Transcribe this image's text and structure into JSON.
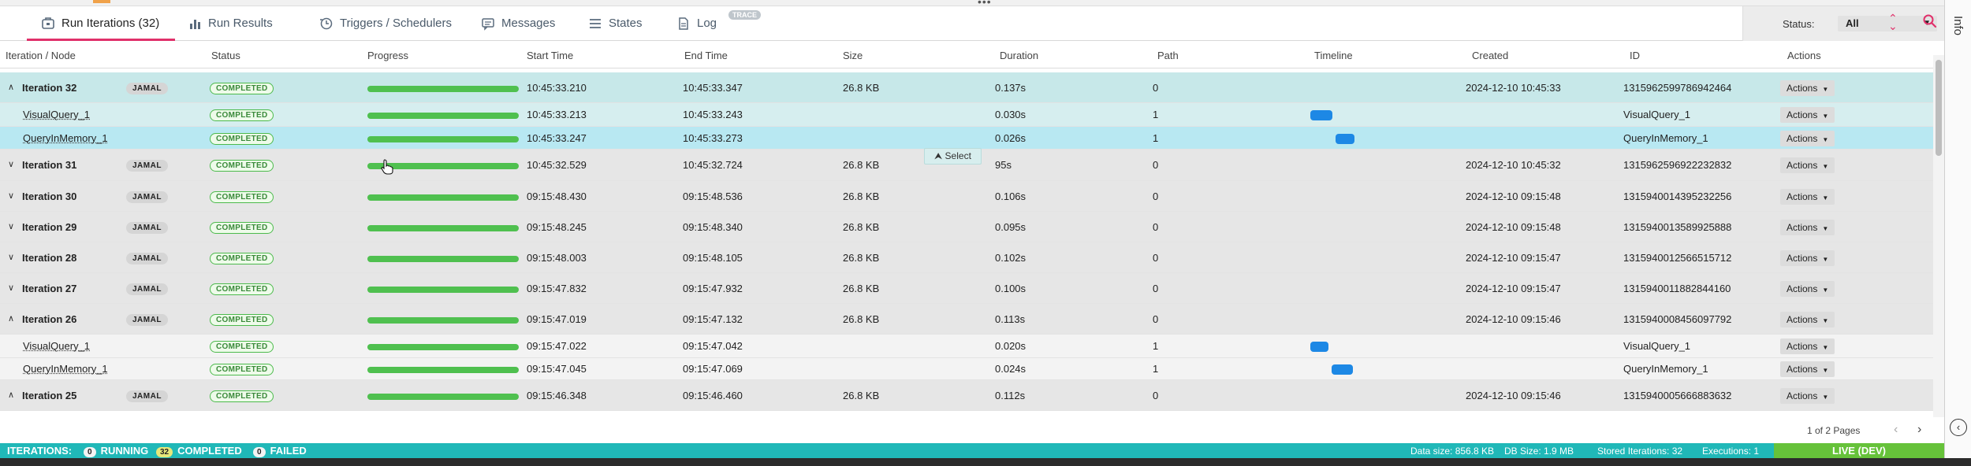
{
  "tabs": [
    {
      "label": "Run Iterations (32)",
      "icon": "run-iterations-icon"
    },
    {
      "label": "Run Results",
      "icon": "bar-chart-icon"
    },
    {
      "label": "Triggers / Schedulers",
      "icon": "triggers-icon"
    },
    {
      "label": "Messages",
      "icon": "messages-icon"
    },
    {
      "label": "States",
      "icon": "list-icon"
    },
    {
      "label": "Log",
      "icon": "log-icon"
    }
  ],
  "trace_badge": "TRACE",
  "filter": {
    "label": "Status:",
    "value": "All"
  },
  "info_label": "Info",
  "columns": [
    "Iteration / Node",
    "Status",
    "Progress",
    "Start Time",
    "End Time",
    "Size",
    "Duration",
    "Path",
    "Timeline",
    "Created",
    "ID",
    "Actions"
  ],
  "rows": [
    {
      "kind": "iter",
      "expanded": true,
      "name": "Iteration 32",
      "user": "JAMAL",
      "status": "COMPLETED",
      "progress": 1.0,
      "start": "10:45:33.210",
      "end": "10:45:33.347",
      "size": "26.8 KB",
      "duration": "0.137s",
      "path": "0",
      "created": "2024-12-10 10:45:33",
      "id": "1315962599786942464",
      "actions": "Actions"
    },
    {
      "kind": "child",
      "name": "VisualQuery_1",
      "status": "COMPLETED",
      "progress": 1.0,
      "start": "10:45:33.213",
      "end": "10:45:33.243",
      "size": "",
      "duration": "0.030s",
      "path": "1",
      "timeline": [
        0.0,
        0.22
      ],
      "created": "",
      "id": "VisualQuery_1",
      "actions": "Actions"
    },
    {
      "kind": "child",
      "selected": true,
      "name": "QueryInMemory_1",
      "status": "COMPLETED",
      "progress": 1.0,
      "start": "10:45:33.247",
      "end": "10:45:33.273",
      "size": "",
      "duration": "0.026s",
      "path": "1",
      "timeline": [
        0.25,
        0.44
      ],
      "created": "",
      "id": "QueryInMemory_1",
      "actions": "Actions"
    },
    {
      "kind": "iter",
      "expanded": false,
      "name": "Iteration 31",
      "user": "JAMAL",
      "status": "COMPLETED",
      "progress": 1.0,
      "start": "10:45:32.529",
      "end": "10:45:32.724",
      "size": "26.8 KB",
      "duration": "0.195s",
      "duration_shown": "95s",
      "path": "0",
      "created": "2024-12-10 10:45:32",
      "id": "1315962596922232832",
      "actions": "Actions"
    },
    {
      "kind": "iter",
      "expanded": false,
      "name": "Iteration 30",
      "user": "JAMAL",
      "status": "COMPLETED",
      "progress": 1.0,
      "start": "09:15:48.430",
      "end": "09:15:48.536",
      "size": "26.8 KB",
      "duration": "0.106s",
      "path": "0",
      "created": "2024-12-10 09:15:48",
      "id": "1315940014395232256",
      "actions": "Actions"
    },
    {
      "kind": "iter",
      "expanded": false,
      "name": "Iteration 29",
      "user": "JAMAL",
      "status": "COMPLETED",
      "progress": 1.0,
      "start": "09:15:48.245",
      "end": "09:15:48.340",
      "size": "26.8 KB",
      "duration": "0.095s",
      "path": "0",
      "created": "2024-12-10 09:15:48",
      "id": "1315940013589925888",
      "actions": "Actions"
    },
    {
      "kind": "iter",
      "expanded": false,
      "name": "Iteration 28",
      "user": "JAMAL",
      "status": "COMPLETED",
      "progress": 1.0,
      "start": "09:15:48.003",
      "end": "09:15:48.105",
      "size": "26.8 KB",
      "duration": "0.102s",
      "path": "0",
      "created": "2024-12-10 09:15:47",
      "id": "1315940012566515712",
      "actions": "Actions"
    },
    {
      "kind": "iter",
      "expanded": false,
      "name": "Iteration 27",
      "user": "JAMAL",
      "status": "COMPLETED",
      "progress": 1.0,
      "start": "09:15:47.832",
      "end": "09:15:47.932",
      "size": "26.8 KB",
      "duration": "0.100s",
      "path": "0",
      "created": "2024-12-10 09:15:47",
      "id": "1315940011882844160",
      "actions": "Actions"
    },
    {
      "kind": "iter",
      "expanded": true,
      "name": "Iteration 26",
      "user": "JAMAL",
      "status": "COMPLETED",
      "progress": 1.0,
      "start": "09:15:47.019",
      "end": "09:15:47.132",
      "size": "26.8 KB",
      "duration": "0.113s",
      "path": "0",
      "created": "2024-12-10 09:15:46",
      "id": "1315940008456097792",
      "actions": "Actions"
    },
    {
      "kind": "child",
      "name": "VisualQuery_1",
      "status": "COMPLETED",
      "progress": 1.0,
      "start": "09:15:47.022",
      "end": "09:15:47.042",
      "size": "",
      "duration": "0.020s",
      "path": "1",
      "timeline": [
        0.0,
        0.18
      ],
      "created": "",
      "id": "VisualQuery_1",
      "actions": "Actions"
    },
    {
      "kind": "child",
      "name": "QueryInMemory_1",
      "status": "COMPLETED",
      "progress": 1.0,
      "start": "09:15:47.045",
      "end": "09:15:47.069",
      "size": "",
      "duration": "0.024s",
      "path": "1",
      "timeline": [
        0.21,
        0.42
      ],
      "created": "",
      "id": "QueryInMemory_1",
      "actions": "Actions"
    },
    {
      "kind": "iter",
      "expanded": true,
      "name": "Iteration 25",
      "user": "JAMAL",
      "status": "COMPLETED",
      "progress": 1.0,
      "start": "09:15:46.348",
      "end": "09:15:46.460",
      "size": "26.8 KB",
      "duration": "0.112s",
      "path": "0",
      "created": "2024-12-10 09:15:46",
      "id": "1315940005666883632",
      "actions": "Actions"
    }
  ],
  "tooltip": "Select",
  "pager": {
    "text": "1 of 2 Pages"
  },
  "statusbar": {
    "label": "ITERATIONS:",
    "running_count": "0",
    "running_label": "RUNNING",
    "completed_count": "32",
    "completed_label": "COMPLETED",
    "failed_count": "0",
    "failed_label": "FAILED",
    "data_size": "Data size: 856.8 KB",
    "db_size": "DB Size: 1.9 MB",
    "stored": "Stored Iterations: 32",
    "executions": "Executions: 1",
    "live": "LIVE (DEV)"
  },
  "colors": {
    "accent": "#e0306a",
    "status_bar": "#20b8b8",
    "progress": "#4fc04f",
    "timeline": "#1d88e5",
    "live": "#66c23a"
  }
}
